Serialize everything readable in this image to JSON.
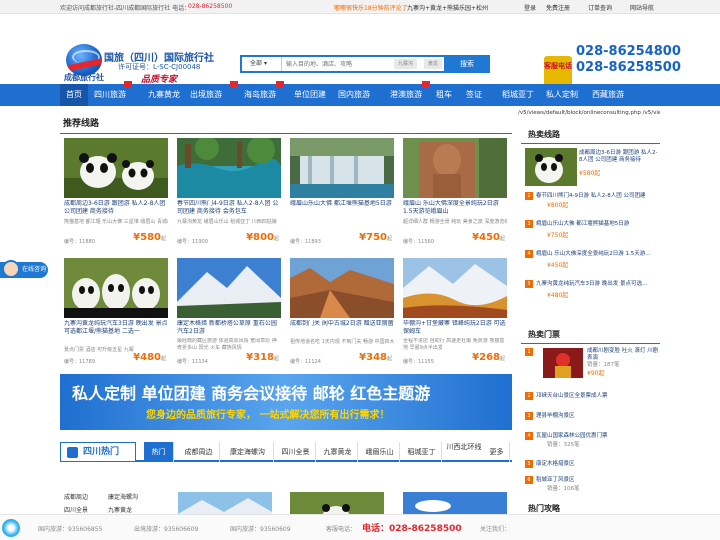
{
  "topbar": {
    "welcome": "欢迎访问成都旅行社-四川成都国际旅行社 电话：",
    "welcome_phone": "028-86258500",
    "promo": "嘟嘟很快乐18分钟前评论了",
    "promo_link": "九寨沟+黄龙+熊猫乐园+松州",
    "login": "登录",
    "register": "免费注册",
    "orders": "订单查询",
    "sitemap": "网站导航"
  },
  "logo": {
    "title": "国旅（四川）国际旅行社",
    "license": "许可证号：L-SC-CJ00048",
    "tagline": "品质专家",
    "name": "成都旅行社"
  },
  "search": {
    "select": "全部",
    "placeholder": "输入目的地、酒店、攻略",
    "tag1": "九寨沟",
    "tag2": "黄龙",
    "button": "搜索"
  },
  "contact": {
    "icon_text": "客服电话",
    "phone1": "028-86254800",
    "phone2": "028-86258500"
  },
  "nav": [
    "首页",
    "四川旅游",
    "九寨黄龙",
    "出境旅游",
    "海岛旅游",
    "单位团建",
    "国内旅游",
    "港澳旅游",
    "租车",
    "签证",
    "稻城亚丁",
    "私人定制",
    "西藏旅游"
  ],
  "section_title": "推荐线路",
  "url_text": "/v5/views/default/block/onlineconsulting.php /v5/views/default/block/",
  "cards": [
    {
      "title": "成都周边3-6日游 跟团游 私人2-8人团 公司团建 商务接待",
      "desc": "熊猫基地 都江堰 乐山大佛 三星堆 峨眉山 青城山",
      "code": "编号：11880",
      "price": "580",
      "unit": "起"
    },
    {
      "title": "春节四川熊门4-9日游 私人2-8人团 公司团建 商务接待 会务包车",
      "desc": "九寨沟黄龙 峨眉山乐山 稻城亚丁 川西四姑娘",
      "code": "编号：11900",
      "price": "800",
      "unit": "起"
    },
    {
      "title": "峨眉山乐山大佛 都江堰熊猫基地5日游",
      "desc": "",
      "code": "编号：11893",
      "price": "750",
      "unit": "起"
    },
    {
      "title": "峨眉山 乐山大佛深度全景纯玩2日游 1.5天游览峨眉山",
      "desc": "超详细人群 畅游全景 纯玩 美食之旅 深度游览峨眉山",
      "code": "编号：11560",
      "price": "450",
      "unit": "起"
    },
    {
      "title": "九寨沟黄龙纯玩汽车3日游 晚出发 景点可选都江堰/熊猫基地 二选一",
      "desc": "景点门票 酒店 可升级五星 九寨",
      "code": "编号：11789",
      "price": "480",
      "unit": "起"
    },
    {
      "title": "康定木格措 新都桥塔公草原 重石公园汽车2日游",
      "desc": "最经典的藏区旅游 体验高原风情 宽阔草原 神奇折多山 阳光 火车 藏族风情",
      "code": "编号：11134",
      "price": "318",
      "unit": "起"
    },
    {
      "title": "成都到门关 阆中古城2日游 赠送亚丽菌",
      "desc": "祖传地道名吃 1天内观 不到门关 畅游 中国四大古城",
      "code": "编号：11124",
      "price": "348",
      "unit": "起"
    },
    {
      "title": "毕棚沟+甘堡藏寨 错峰纯玩2日游 可选保姆车",
      "desc": "全程不进店 自助行 高速走杜甫 免费游 熊猫基地 早晨9点半出发",
      "code": "编号：11155",
      "price": "268",
      "unit": "起"
    }
  ],
  "banner": {
    "line1": "私人定制 单位团建 商务会议接待 邮轮 红色主题游",
    "line2": "您身边的品质旅行专家， 一站式解决您所有出行需求！"
  },
  "hot": {
    "title": "四川热门",
    "tabs": [
      "热门",
      "成都周边",
      "康定海螺沟",
      "四川全景",
      "九寨黄龙",
      "峨眉乐山",
      "稻城亚丁",
      "川西北环线",
      "更多"
    ]
  },
  "bottom_left": [
    "成都周边",
    "康定海螺沟",
    "四川全景",
    "九寨黄龙"
  ],
  "sidebar": {
    "hot_lines_title": "热卖线路",
    "hot_lines": [
      {
        "n": "1",
        "title": "成都周边3-6日游 跟团游 私人2-8人团 公司团建 商务接待",
        "price": "¥580起"
      },
      {
        "n": "2",
        "title": "春节四川熊门4-9日游 私人2-8人团 公司团建",
        "price": "¥800起"
      },
      {
        "n": "3",
        "title": "峨眉山乐山大佛 都江堰熊猫基地5日游",
        "price": "¥750起"
      },
      {
        "n": "4",
        "title": "峨眉山 乐山大佛深度全景纯玩2日游 1.5天游...",
        "price": "¥450起"
      },
      {
        "n": "5",
        "title": "九寨沟黄龙纯玩汽车3日游 晚出发 景点可选...",
        "price": "¥480起"
      }
    ],
    "tickets_title": "热卖门票",
    "tickets": [
      {
        "n": "1",
        "title": "成都川剧变脸 吐火 滚灯 川剧表演",
        "sub": "销量：187笔",
        "price": "¥90起"
      },
      {
        "n": "2",
        "title": "邛崃天台山景区全景票成人票",
        "sub": "",
        "price": ""
      },
      {
        "n": "3",
        "title": "理县毕棚沟景区",
        "sub": "",
        "price": ""
      },
      {
        "n": "4",
        "title": "瓦屋山国家森林公园优惠门票",
        "sub": "销量：325笔",
        "price": ""
      },
      {
        "n": "5",
        "title": "康定木格措景区",
        "sub": "",
        "price": ""
      },
      {
        "n": "6",
        "title": "稻城亚丁风景区",
        "sub": "销量：106笔",
        "price": ""
      }
    ],
    "partial_title": "热门攻略"
  },
  "footer": {
    "f1": "国内旅游：935606855",
    "f2": "出境旅游：935606609",
    "f3": "国内旅游：93560609",
    "f4": "客服电话：",
    "f4_phone": "电话：028-86258500",
    "f5": "关注我们："
  },
  "consult": "在线咨询",
  "colors": {
    "brand": "#1f6fd0",
    "price": "#f26b00",
    "accent": "#e4262d"
  }
}
